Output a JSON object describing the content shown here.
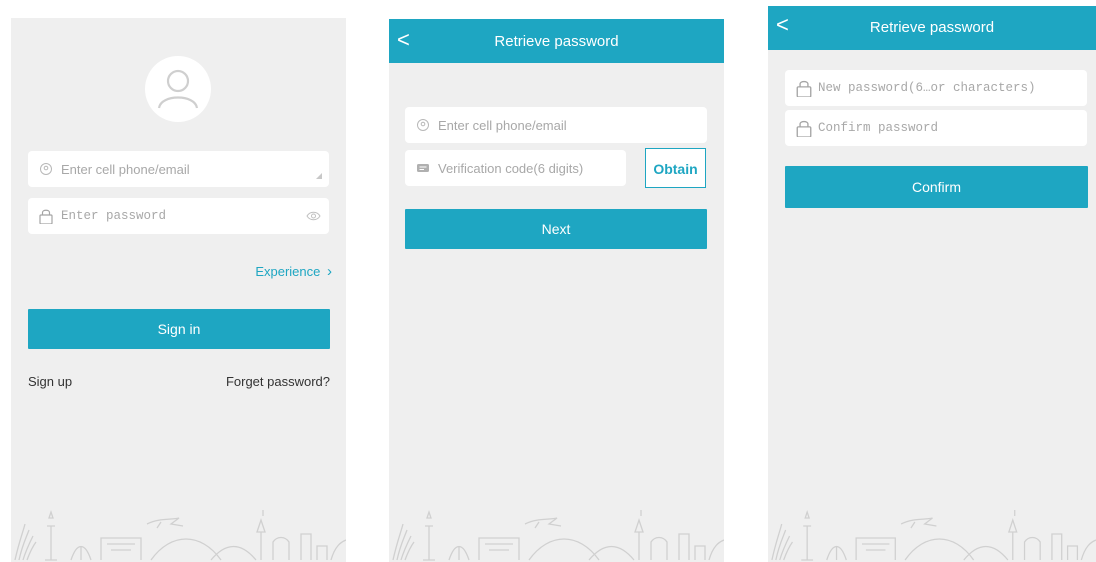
{
  "login": {
    "phone_placeholder": "Enter cell phone/email",
    "password_placeholder": "Enter password",
    "experience_label": "Experience",
    "signin_label": "Sign in",
    "signup_label": "Sign up",
    "forget_label": "Forget password?"
  },
  "retrieve_step1": {
    "title": "Retrieve password",
    "back_label": "<",
    "phone_placeholder": "Enter cell phone/email",
    "code_placeholder": "Verification code(6 digits)",
    "obtain_label": "Obtain",
    "next_label": "Next"
  },
  "retrieve_step2": {
    "title": "Retrieve password",
    "back_label": "<",
    "new_password_placeholder": "New password(6…or characters)",
    "confirm_password_placeholder": "Confirm password",
    "confirm_label": "Confirm"
  },
  "colors": {
    "accent": "#1ea6c2",
    "background": "#efefef",
    "field": "#ffffff"
  }
}
